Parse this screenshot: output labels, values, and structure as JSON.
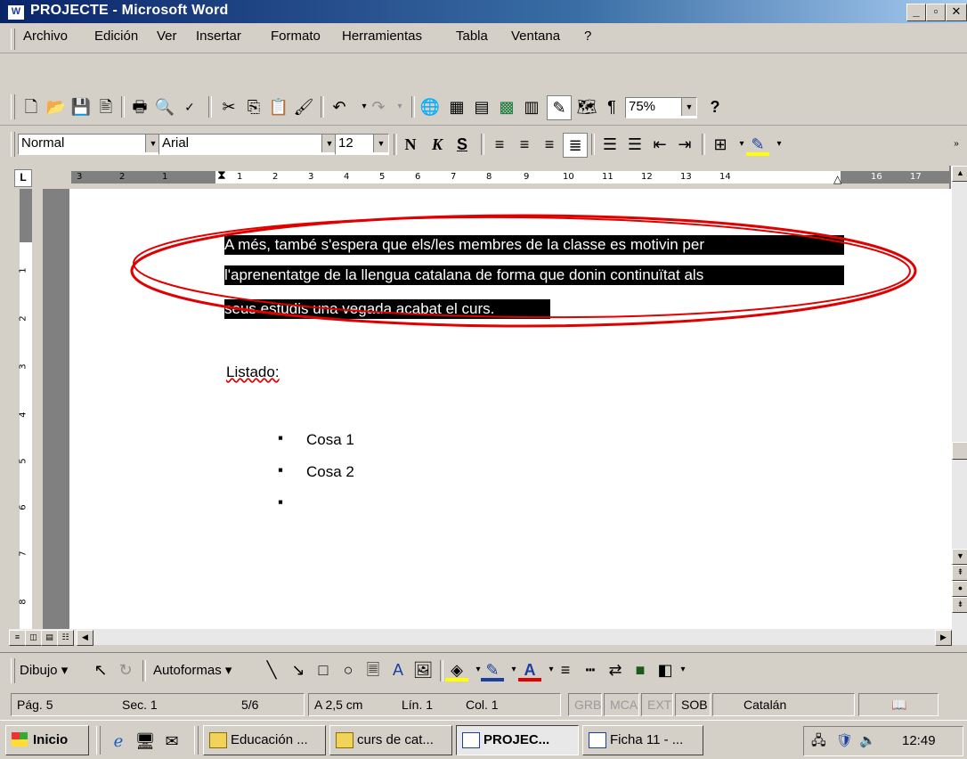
{
  "window": {
    "title": "PROJECTE - Microsoft Word",
    "icon": "word-doc-icon"
  },
  "menu": [
    "Archivo",
    "Edición",
    "Ver",
    "Insertar",
    "Formato",
    "Herramientas",
    "Tabla",
    "Ventana",
    "?"
  ],
  "toolbar": {
    "zoom": "75%",
    "help_icon": "help-icon"
  },
  "format": {
    "style": "Normal",
    "font": "Arial",
    "size": "12",
    "bold": "N",
    "italic": "K",
    "underline": "S"
  },
  "ruler": {
    "h_labels": [
      "3",
      "2",
      "1",
      "1",
      "2",
      "3",
      "4",
      "5",
      "6",
      "7",
      "8",
      "9",
      "10",
      "11",
      "12",
      "13",
      "14",
      "16",
      "17"
    ],
    "v_labels": [
      "1",
      "2",
      "3",
      "4",
      "5",
      "6",
      "7",
      "8"
    ]
  },
  "document": {
    "selected_lines": [
      "A més, també s'espera que els/les membres de la classe es motivin per",
      "l'aprenentatge de la llengua catalana de forma que donin continuïtat  als",
      "seus estudis una vegada acabat el curs."
    ],
    "heading": "Listado:",
    "bullets": [
      "Cosa 1",
      "Cosa 2",
      ""
    ]
  },
  "drawing_toolbar": {
    "draw": "Dibujo",
    "autoshapes": "Autoformas"
  },
  "status": {
    "page": "Pág. 5",
    "section": "Sec. 1",
    "pages": "5/6",
    "at": "A 2,5 cm",
    "line": "Lín. 1",
    "col": "Col. 1",
    "rec": "GRB",
    "trk": "MCA",
    "ext": "EXT",
    "ovr": "SOB",
    "lang": "Catalán"
  },
  "taskbar": {
    "start": "Inicio",
    "tasks": [
      "Educación ...",
      "curs de cat...",
      "PROJEC...",
      "Ficha 11 - ..."
    ],
    "clock": "12:49"
  },
  "colors": {
    "title_start": "#0a246a",
    "annotation_ellipse": "#e00000",
    "selection": "#000000"
  }
}
